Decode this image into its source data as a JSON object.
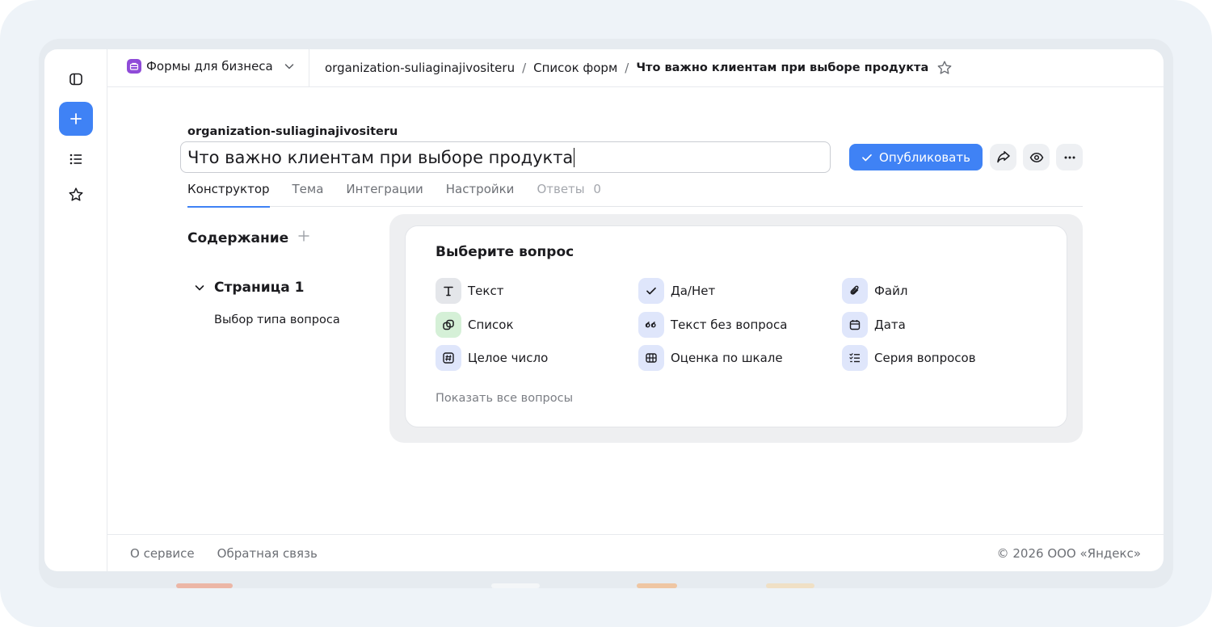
{
  "product": {
    "name": "Формы для бизнеса",
    "icon": "briefcase-icon",
    "color": "#8f4bd8"
  },
  "breadcrumbs": {
    "org": "organization-suliaginajivositeru",
    "list": "Список форм",
    "current": "Что важно клиентам при выборе продукта",
    "separator": "/"
  },
  "form": {
    "org": "organization-suliaginajivositeru",
    "title": "Что важно клиентам при выборе продукта"
  },
  "actions": {
    "publish_label": "Опубликовать",
    "share_icon": "share-icon",
    "preview_icon": "eye-icon",
    "more_icon": "more-icon"
  },
  "tabs": [
    {
      "label": "Конструктор",
      "state": "active"
    },
    {
      "label": "Тема",
      "state": "normal"
    },
    {
      "label": "Интеграции",
      "state": "normal"
    },
    {
      "label": "Настройки",
      "state": "normal"
    },
    {
      "label": "Ответы",
      "count": "0",
      "state": "disabled"
    }
  ],
  "contents": {
    "title": "Содержание",
    "page": "Страница 1",
    "item": "Выбор типа вопроса"
  },
  "question_picker": {
    "title": "Выберите вопрос",
    "types": [
      {
        "label": "Текст",
        "icon": "text-icon",
        "bg": "#e4e6ea"
      },
      {
        "label": "Да/Нет",
        "icon": "check-icon",
        "bg": "#dfe6fb"
      },
      {
        "label": "Файл",
        "icon": "paperclip-icon",
        "bg": "#dfe6fb"
      },
      {
        "label": "Список",
        "icon": "list-choice-icon",
        "bg": "#d5f0d7"
      },
      {
        "label": "Текст без вопроса",
        "icon": "quote-icon",
        "bg": "#dfe6fb"
      },
      {
        "label": "Дата",
        "icon": "calendar-icon",
        "bg": "#dfe6fb"
      },
      {
        "label": "Целое число",
        "icon": "hash-icon",
        "bg": "#dfe6fb"
      },
      {
        "label": "Оценка по шкале",
        "icon": "grid-icon",
        "bg": "#dfe6fb"
      },
      {
        "label": "Серия вопросов",
        "icon": "checklist-icon",
        "bg": "#dfe6fb"
      }
    ],
    "show_all": "Показать все вопросы"
  },
  "footer": {
    "about": "О сервисе",
    "feedback": "Обратная связь",
    "copyright": "© 2026 ООО «Яндекс»"
  },
  "colors": {
    "accent": "#3f82f5",
    "text": "#1b1b1f",
    "muted": "#6d7076"
  }
}
